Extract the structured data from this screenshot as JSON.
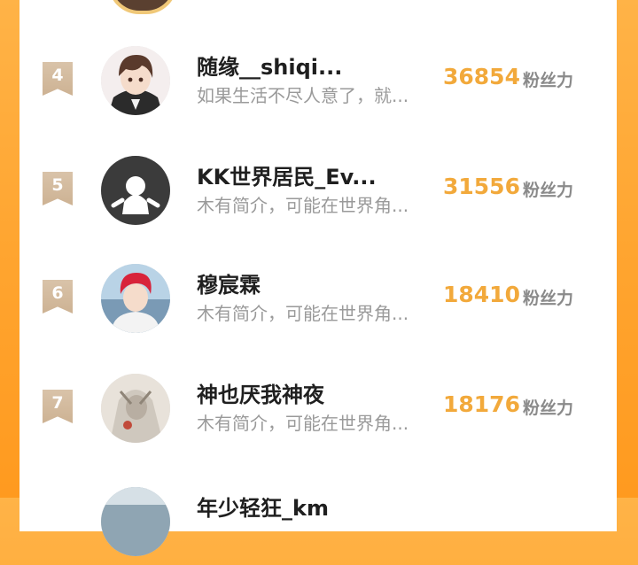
{
  "fan_label": "粉丝力",
  "entries": [
    {
      "rank": "4",
      "name": "随缘__shiqi...",
      "bio": "如果生活不尽人意了，就...",
      "fans": "36854"
    },
    {
      "rank": "5",
      "name": "KK世界居民_Ev...",
      "bio": "木有简介，可能在世界角...",
      "fans": "31556"
    },
    {
      "rank": "6",
      "name": "穆宸霖",
      "bio": "木有简介，可能在世界角...",
      "fans": "18410"
    },
    {
      "rank": "7",
      "name": "神也厌我神夜",
      "bio": "木有简介，可能在世界角...",
      "fans": "18176"
    },
    {
      "rank": "",
      "name": "年少轻狂_km",
      "bio": "",
      "fans": ""
    }
  ],
  "colors": {
    "accent": "#f2a93b",
    "background": "#ffa530",
    "rank_flag": "#d4b99b"
  }
}
